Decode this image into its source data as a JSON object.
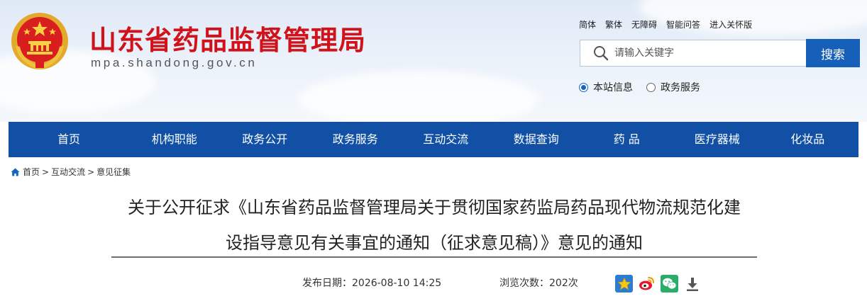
{
  "header": {
    "site_title": "山东省药品监督管理局",
    "site_domain": "mpa.shandong.gov.cn",
    "top_links": [
      "简体",
      "繁体",
      "无障碍",
      "智能问答",
      "进入关怀版"
    ]
  },
  "search": {
    "placeholder": "请输入关键字",
    "button_label": "搜索",
    "scopes": [
      {
        "label": "本站信息",
        "selected": true
      },
      {
        "label": "政务服务",
        "selected": false
      }
    ]
  },
  "nav": {
    "items": [
      "首页",
      "机构职能",
      "政务公开",
      "政务服务",
      "互动交流",
      "数据查询",
      "药 品",
      "医疗器械",
      "化妆品"
    ]
  },
  "breadcrumb": {
    "items": [
      "首页",
      "互动交流",
      "意见征集"
    ],
    "separator": ">"
  },
  "article": {
    "title_line1": "关于公开征求《山东省药品监督管理局关于贯彻国家药监局药品现代物流规范化建",
    "title_line2": "设指导意见有关事宜的通知（征求意见稿）》意见的通知",
    "publish_date": "发布日期：2026-08-10 14:25",
    "view_count": "浏览次数：202次"
  },
  "colors": {
    "brand_red": "#d0121b",
    "nav_blue": "#1150a5",
    "search_button": "#1760b9"
  },
  "icons": {
    "share": [
      "favorite-star-icon",
      "weibo-icon",
      "wechat-icon",
      "download-icon"
    ]
  }
}
